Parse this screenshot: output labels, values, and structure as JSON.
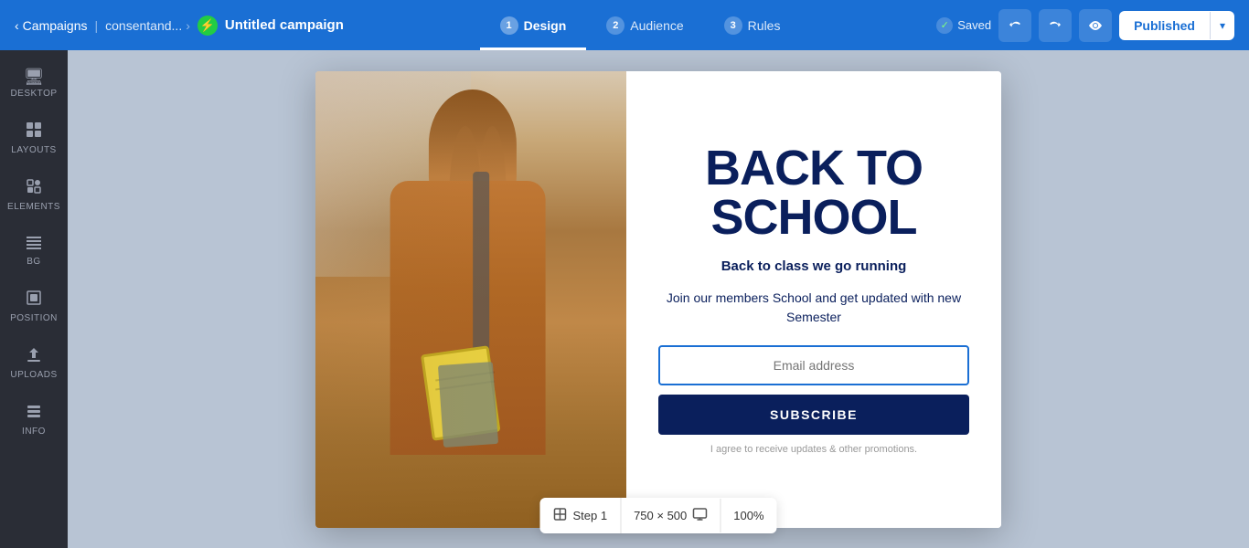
{
  "topnav": {
    "campaigns_label": "Campaigns",
    "breadcrumb_label": "consentand...",
    "campaign_title": "Untitled campaign",
    "tabs": [
      {
        "num": "1",
        "label": "Design",
        "active": true
      },
      {
        "num": "2",
        "label": "Audience",
        "active": false
      },
      {
        "num": "3",
        "label": "Rules",
        "active": false
      }
    ],
    "saved_label": "Saved",
    "publish_label": "Published"
  },
  "sidebar": {
    "items": [
      {
        "icon": "🖥",
        "label": "DESKTOP"
      },
      {
        "icon": "⊞",
        "label": "LAYOUTS"
      },
      {
        "icon": "◱",
        "label": "ELEMENTS"
      },
      {
        "icon": "≡",
        "label": "BG"
      },
      {
        "icon": "⊡",
        "label": "POSITION"
      },
      {
        "icon": "↑",
        "label": "UPLOADS"
      },
      {
        "icon": "⌨",
        "label": "INFO"
      }
    ]
  },
  "popup": {
    "headline": "BACK TO SCHOOL",
    "subheadline": "Back to class we go running",
    "body_text": "Join our members School and get updated with new Semester",
    "email_placeholder": "Email address",
    "subscribe_label": "SUBSCRIBE",
    "disclaimer": "I agree to receive updates & other promotions."
  },
  "bottombar": {
    "step_icon": "⊞",
    "step_label": "Step 1",
    "dimensions": "750 × 500",
    "monitor_icon": "⊡",
    "zoom": "100%"
  }
}
